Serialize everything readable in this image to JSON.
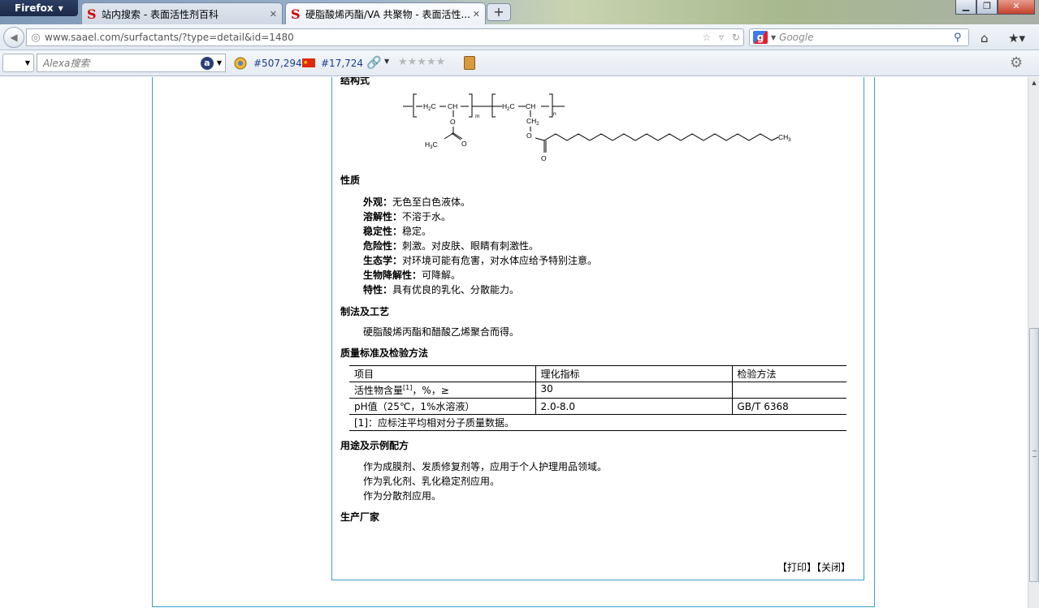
{
  "browser": {
    "app_button": "Firefox",
    "tabs": [
      {
        "title": "站内搜索 - 表面活性剂百科",
        "active": false
      },
      {
        "title": "硬脂酸烯丙酯/VA 共聚物 - 表面活性...",
        "active": true
      }
    ],
    "url": "www.saael.com/surfactants/?type=detail&id=1480",
    "search_placeholder": "Google",
    "alexa_placeholder": "Alexa搜索",
    "alexa_rank": "#507,294",
    "country_rank": "#17,724",
    "favicon_letter": "S",
    "icons": [
      "back-icon",
      "globe-icon",
      "star-icon",
      "reload-icon",
      "home-icon",
      "bookmarks-icon",
      "gear-icon",
      "search-icon"
    ]
  },
  "structure": {
    "heading": "结构式",
    "labels": {
      "h2c": "H2C",
      "ch": "CH",
      "o": "O",
      "ch2": "CH2",
      "h3c": "H3C",
      "ch3": "CH3",
      "m": "m",
      "n": "n"
    }
  },
  "properties": {
    "heading": "性质",
    "items": [
      {
        "key": "外观：",
        "value": "无色至白色液体。"
      },
      {
        "key": "溶解性：",
        "value": "不溶于水。"
      },
      {
        "key": "稳定性：",
        "value": "稳定。"
      },
      {
        "key": "危险性：",
        "value": "刺激。对皮肤、眼睛有刺激性。"
      },
      {
        "key": "生态学：",
        "value": "对环境可能有危害，对水体应给予特别注意。"
      },
      {
        "key": "生物降解性：",
        "value": "可降解。"
      },
      {
        "key": "特性：",
        "value": "具有优良的乳化、分散能力。"
      }
    ]
  },
  "process": {
    "heading": "制法及工艺",
    "text": "硬脂酸烯丙酯和醋酸乙烯聚合而得。"
  },
  "quality": {
    "heading": "质量标准及检验方法",
    "columns": [
      "项目",
      "理化指标",
      "检验方法"
    ],
    "rows": [
      {
        "item": "活性物含量",
        "sup": "[1]",
        "suffix": "，%，≥",
        "spec": "30",
        "method": ""
      },
      {
        "item": "pH值（25℃，1%水溶液）",
        "sup": "",
        "suffix": "",
        "spec": "2.0-8.0",
        "method": "GB/T 6368"
      }
    ],
    "footnote": "[1]：应标注平均相对分子质量数据。"
  },
  "uses": {
    "heading": "用途及示例配方",
    "lines": [
      "作为成膜剂、发质修复剂等，应用于个人护理用品领域。",
      "作为乳化剂、乳化稳定剂应用。",
      "作为分散剂应用。"
    ]
  },
  "manufacturer": {
    "heading": "生产厂家"
  },
  "footer_links": {
    "print": "【打印】",
    "close": "【关闭】"
  }
}
